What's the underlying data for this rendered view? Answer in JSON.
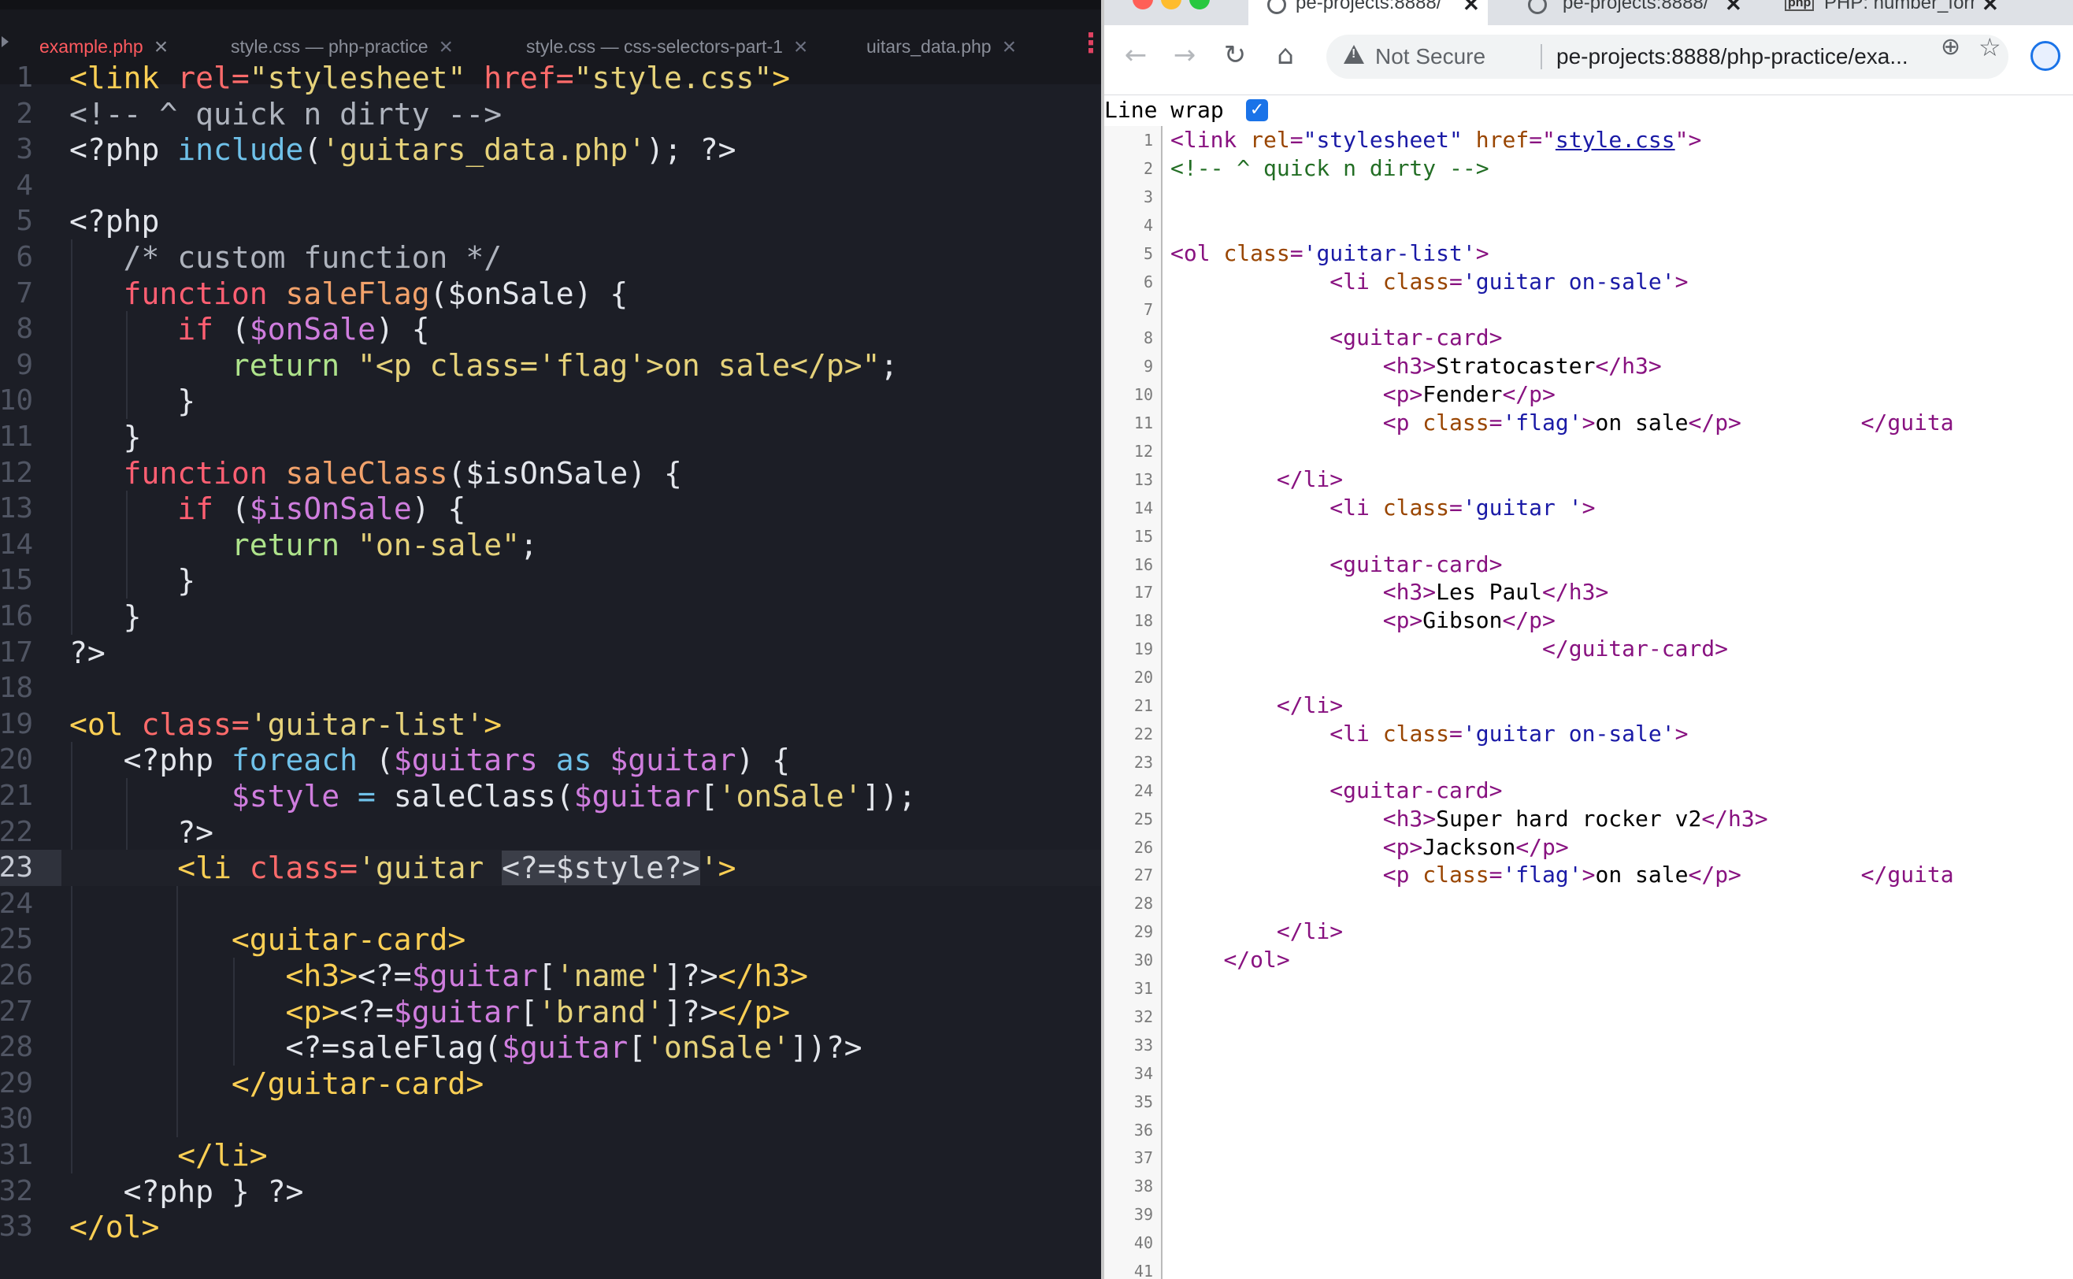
{
  "editor": {
    "tabs": [
      {
        "label": "example.php",
        "active": true
      },
      {
        "label": "style.css — php-practice",
        "active": false
      },
      {
        "label": "style.css — css-selectors-part-1",
        "active": false
      },
      {
        "label": "uitars_data.php",
        "active": false
      }
    ],
    "current_line": 23,
    "lines": [
      {
        "n": "1",
        "segs": [
          [
            "t-tagy",
            "<link "
          ],
          [
            "t-attr",
            "rel="
          ],
          [
            "t-str",
            "\"stylesheet\""
          ],
          [
            "t-attr",
            " href="
          ],
          [
            "t-str",
            "\"style.css\""
          ],
          [
            "t-tagy",
            ">"
          ]
        ]
      },
      {
        "n": "2",
        "segs": [
          [
            "t-com",
            "<!-- ^ quick n dirty -->"
          ]
        ]
      },
      {
        "n": "3",
        "segs": [
          [
            "t-pl",
            "<?php "
          ],
          [
            "t-blu",
            "include"
          ],
          [
            "t-pl",
            "("
          ],
          [
            "t-str",
            "'guitars_data.php'"
          ],
          [
            "t-pl",
            "); ?>"
          ]
        ]
      },
      {
        "n": "4",
        "segs": []
      },
      {
        "n": "5",
        "segs": [
          [
            "t-pl",
            "<?php"
          ]
        ]
      },
      {
        "n": "6",
        "segs": [
          [
            "t-com",
            "   /* custom function */"
          ]
        ]
      },
      {
        "n": "7",
        "segs": [
          [
            "t-kw",
            "   function "
          ],
          [
            "t-fn",
            "saleFlag"
          ],
          [
            "t-pl",
            "($onSale) {"
          ]
        ]
      },
      {
        "n": "8",
        "segs": [
          [
            "t-kw",
            "      if "
          ],
          [
            "t-pl",
            "("
          ],
          [
            "t-var",
            "$onSale"
          ],
          [
            "t-pl",
            ") {"
          ]
        ]
      },
      {
        "n": "9",
        "segs": [
          [
            "t-ret",
            "         return "
          ],
          [
            "t-str",
            "\"<p class='flag'>on sale</p>\""
          ],
          [
            "t-pl",
            ";"
          ]
        ]
      },
      {
        "n": "10",
        "segs": [
          [
            "t-pl",
            "      }"
          ]
        ]
      },
      {
        "n": "11",
        "segs": [
          [
            "t-pl",
            "   }"
          ]
        ]
      },
      {
        "n": "12",
        "segs": [
          [
            "t-kw",
            "   function "
          ],
          [
            "t-fn",
            "saleClass"
          ],
          [
            "t-pl",
            "($isOnSale) {"
          ]
        ]
      },
      {
        "n": "13",
        "segs": [
          [
            "t-kw",
            "      if "
          ],
          [
            "t-pl",
            "("
          ],
          [
            "t-var",
            "$isOnSale"
          ],
          [
            "t-pl",
            ") {"
          ]
        ]
      },
      {
        "n": "14",
        "segs": [
          [
            "t-ret",
            "         return "
          ],
          [
            "t-str",
            "\"on-sale\""
          ],
          [
            "t-pl",
            ";"
          ]
        ]
      },
      {
        "n": "15",
        "segs": [
          [
            "t-pl",
            "      }"
          ]
        ]
      },
      {
        "n": "16",
        "segs": [
          [
            "t-pl",
            "   }"
          ]
        ]
      },
      {
        "n": "17",
        "segs": [
          [
            "t-pl",
            "?>"
          ]
        ]
      },
      {
        "n": "18",
        "segs": []
      },
      {
        "n": "19",
        "segs": [
          [
            "t-tagy",
            "<ol "
          ],
          [
            "t-attr",
            "class="
          ],
          [
            "t-str",
            "'guitar-list'"
          ],
          [
            "t-tagy",
            ">"
          ]
        ]
      },
      {
        "n": "20",
        "segs": [
          [
            "t-pl",
            "   <?php "
          ],
          [
            "t-blu",
            "foreach "
          ],
          [
            "t-pl",
            "("
          ],
          [
            "t-var",
            "$guitars"
          ],
          [
            "t-blu",
            " as "
          ],
          [
            "t-var",
            "$guitar"
          ],
          [
            "t-pl",
            ") {"
          ]
        ]
      },
      {
        "n": "21",
        "segs": [
          [
            "t-var",
            "         $style "
          ],
          [
            "t-blu",
            "= "
          ],
          [
            "t-pl",
            "saleClass("
          ],
          [
            "t-var",
            "$guitar"
          ],
          [
            "t-pl",
            "["
          ],
          [
            "t-str",
            "'onSale'"
          ],
          [
            "t-pl",
            "]);"
          ]
        ]
      },
      {
        "n": "22",
        "segs": [
          [
            "t-pl",
            "      ?>"
          ]
        ]
      },
      {
        "n": "23",
        "segs": [
          [
            "t-tagy",
            "      <li "
          ],
          [
            "t-attr",
            "class="
          ],
          [
            "t-str",
            "'guitar "
          ],
          [
            "t-hl",
            "<?=$style?>"
          ],
          [
            "t-str",
            "'"
          ],
          [
            "t-tagy",
            ">"
          ]
        ]
      },
      {
        "n": "24",
        "segs": []
      },
      {
        "n": "25",
        "segs": [
          [
            "t-tagy",
            "         <guitar-card>"
          ]
        ]
      },
      {
        "n": "26",
        "segs": [
          [
            "t-tagy",
            "            <h3>"
          ],
          [
            "t-pl",
            "<?="
          ],
          [
            "t-var",
            "$guitar"
          ],
          [
            "t-pl",
            "["
          ],
          [
            "t-str",
            "'name'"
          ],
          [
            "t-pl",
            "]?>"
          ],
          [
            "t-tagy",
            "</h3>"
          ]
        ]
      },
      {
        "n": "27",
        "segs": [
          [
            "t-tagy",
            "            <p>"
          ],
          [
            "t-pl",
            "<?="
          ],
          [
            "t-var",
            "$guitar"
          ],
          [
            "t-pl",
            "["
          ],
          [
            "t-str",
            "'brand'"
          ],
          [
            "t-pl",
            "]?>"
          ],
          [
            "t-tagy",
            "</p>"
          ]
        ]
      },
      {
        "n": "28",
        "segs": [
          [
            "t-pl",
            "            <?=saleFlag("
          ],
          [
            "t-var",
            "$guitar"
          ],
          [
            "t-pl",
            "["
          ],
          [
            "t-str",
            "'onSale'"
          ],
          [
            "t-pl",
            "])?>"
          ]
        ]
      },
      {
        "n": "29",
        "segs": [
          [
            "t-tagy",
            "         </guitar-card>"
          ]
        ]
      },
      {
        "n": "30",
        "segs": []
      },
      {
        "n": "31",
        "segs": [
          [
            "t-tagy",
            "      </li>"
          ]
        ]
      },
      {
        "n": "32",
        "segs": [
          [
            "t-pl",
            "   <?php } ?>"
          ]
        ]
      },
      {
        "n": "33",
        "segs": [
          [
            "t-tagy",
            "</ol>"
          ]
        ]
      }
    ]
  },
  "browser": {
    "tabs": [
      {
        "label": "pe-projects:8888/",
        "icon": "globe-icon",
        "active": true
      },
      {
        "label": "pe-projects:8888/",
        "icon": "globe-icon",
        "active": false
      },
      {
        "label": "PHP: number_form",
        "icon": "php-icon",
        "active": false
      }
    ],
    "security_label": "Not Secure",
    "url": "pe-projects:8888/php-practice/exa...",
    "line_wrap_label": "Line wrap",
    "line_wrap_checked": true,
    "source_lines": [
      {
        "n": "1",
        "segs": [
          [
            "s-tag",
            "<link "
          ],
          [
            "s-an",
            "rel"
          ],
          [
            "s-tag",
            "="
          ],
          [
            "s-av",
            "\"stylesheet\""
          ],
          [
            "s-tag",
            " "
          ],
          [
            "s-an",
            "href"
          ],
          [
            "s-tag",
            "=\""
          ],
          [
            "s-link",
            "style.css"
          ],
          [
            "s-tag",
            "\">"
          ]
        ]
      },
      {
        "n": "2",
        "segs": [
          [
            "s-com",
            "<!-- ^ quick n dirty -->"
          ]
        ]
      },
      {
        "n": "3",
        "segs": []
      },
      {
        "n": "4",
        "segs": []
      },
      {
        "n": "5",
        "segs": [
          [
            "s-tag",
            "<ol "
          ],
          [
            "s-an",
            "class"
          ],
          [
            "s-tag",
            "="
          ],
          [
            "s-av",
            "'guitar-list'"
          ],
          [
            "s-tag",
            ">"
          ]
        ]
      },
      {
        "n": "6",
        "segs": [
          [
            "",
            "            "
          ],
          [
            "s-tag",
            "<li "
          ],
          [
            "s-an",
            "class"
          ],
          [
            "s-tag",
            "="
          ],
          [
            "s-av",
            "'guitar on-sale'"
          ],
          [
            "s-tag",
            ">"
          ]
        ]
      },
      {
        "n": "7",
        "segs": []
      },
      {
        "n": "8",
        "segs": [
          [
            "",
            "            "
          ],
          [
            "s-tag",
            "<guitar-card>"
          ]
        ]
      },
      {
        "n": "9",
        "segs": [
          [
            "",
            "                "
          ],
          [
            "s-tag",
            "<h3>"
          ],
          [
            "",
            "Stratocaster"
          ],
          [
            "s-tag",
            "</h3>"
          ]
        ]
      },
      {
        "n": "10",
        "segs": [
          [
            "",
            "                "
          ],
          [
            "s-tag",
            "<p>"
          ],
          [
            "",
            "Fender"
          ],
          [
            "s-tag",
            "</p>"
          ]
        ]
      },
      {
        "n": "11",
        "segs": [
          [
            "",
            "                "
          ],
          [
            "s-tag",
            "<p "
          ],
          [
            "s-an",
            "class"
          ],
          [
            "s-tag",
            "="
          ],
          [
            "s-av",
            "'flag'"
          ],
          [
            "s-tag",
            ">"
          ],
          [
            "",
            "on sale"
          ],
          [
            "s-tag",
            "</p>"
          ],
          [
            "",
            "         "
          ],
          [
            "s-tag",
            "</guita"
          ]
        ]
      },
      {
        "n": "12",
        "segs": []
      },
      {
        "n": "13",
        "segs": [
          [
            "",
            "        "
          ],
          [
            "s-tag",
            "</li>"
          ]
        ]
      },
      {
        "n": "14",
        "segs": [
          [
            "",
            "            "
          ],
          [
            "s-tag",
            "<li "
          ],
          [
            "s-an",
            "class"
          ],
          [
            "s-tag",
            "="
          ],
          [
            "s-av",
            "'guitar '"
          ],
          [
            "s-tag",
            ">"
          ]
        ]
      },
      {
        "n": "15",
        "segs": []
      },
      {
        "n": "16",
        "segs": [
          [
            "",
            "            "
          ],
          [
            "s-tag",
            "<guitar-card>"
          ]
        ]
      },
      {
        "n": "17",
        "segs": [
          [
            "",
            "                "
          ],
          [
            "s-tag",
            "<h3>"
          ],
          [
            "",
            "Les Paul"
          ],
          [
            "s-tag",
            "</h3>"
          ]
        ]
      },
      {
        "n": "18",
        "segs": [
          [
            "",
            "                "
          ],
          [
            "s-tag",
            "<p>"
          ],
          [
            "",
            "Gibson"
          ],
          [
            "s-tag",
            "</p>"
          ]
        ]
      },
      {
        "n": "19",
        "segs": [
          [
            "",
            "                            "
          ],
          [
            "s-tag",
            "</guitar-card>"
          ]
        ]
      },
      {
        "n": "20",
        "segs": []
      },
      {
        "n": "21",
        "segs": [
          [
            "",
            "        "
          ],
          [
            "s-tag",
            "</li>"
          ]
        ]
      },
      {
        "n": "22",
        "segs": [
          [
            "",
            "            "
          ],
          [
            "s-tag",
            "<li "
          ],
          [
            "s-an",
            "class"
          ],
          [
            "s-tag",
            "="
          ],
          [
            "s-av",
            "'guitar on-sale'"
          ],
          [
            "s-tag",
            ">"
          ]
        ]
      },
      {
        "n": "23",
        "segs": []
      },
      {
        "n": "24",
        "segs": [
          [
            "",
            "            "
          ],
          [
            "s-tag",
            "<guitar-card>"
          ]
        ]
      },
      {
        "n": "25",
        "segs": [
          [
            "",
            "                "
          ],
          [
            "s-tag",
            "<h3>"
          ],
          [
            "",
            "Super hard rocker v2"
          ],
          [
            "s-tag",
            "</h3>"
          ]
        ]
      },
      {
        "n": "26",
        "segs": [
          [
            "",
            "                "
          ],
          [
            "s-tag",
            "<p>"
          ],
          [
            "",
            "Jackson"
          ],
          [
            "s-tag",
            "</p>"
          ]
        ]
      },
      {
        "n": "27",
        "segs": [
          [
            "",
            "                "
          ],
          [
            "s-tag",
            "<p "
          ],
          [
            "s-an",
            "class"
          ],
          [
            "s-tag",
            "="
          ],
          [
            "s-av",
            "'flag'"
          ],
          [
            "s-tag",
            ">"
          ],
          [
            "",
            "on sale"
          ],
          [
            "s-tag",
            "</p>"
          ],
          [
            "",
            "         "
          ],
          [
            "s-tag",
            "</guita"
          ]
        ]
      },
      {
        "n": "28",
        "segs": []
      },
      {
        "n": "29",
        "segs": [
          [
            "",
            "        "
          ],
          [
            "s-tag",
            "</li>"
          ]
        ]
      },
      {
        "n": "30",
        "segs": [
          [
            "",
            "    "
          ],
          [
            "s-tag",
            "</ol>"
          ]
        ]
      },
      {
        "n": "31",
        "segs": []
      },
      {
        "n": "32",
        "segs": []
      },
      {
        "n": "33",
        "segs": []
      },
      {
        "n": "34",
        "segs": []
      },
      {
        "n": "35",
        "segs": []
      },
      {
        "n": "36",
        "segs": []
      },
      {
        "n": "37",
        "segs": []
      },
      {
        "n": "38",
        "segs": []
      },
      {
        "n": "39",
        "segs": []
      },
      {
        "n": "40",
        "segs": []
      },
      {
        "n": "41",
        "segs": []
      }
    ]
  },
  "colors": {
    "editor_bg": "#1c1e26",
    "active_tab_text": "#ff5a5f",
    "source_tag": "#881280",
    "source_attr_value": "#1a1aa6"
  }
}
